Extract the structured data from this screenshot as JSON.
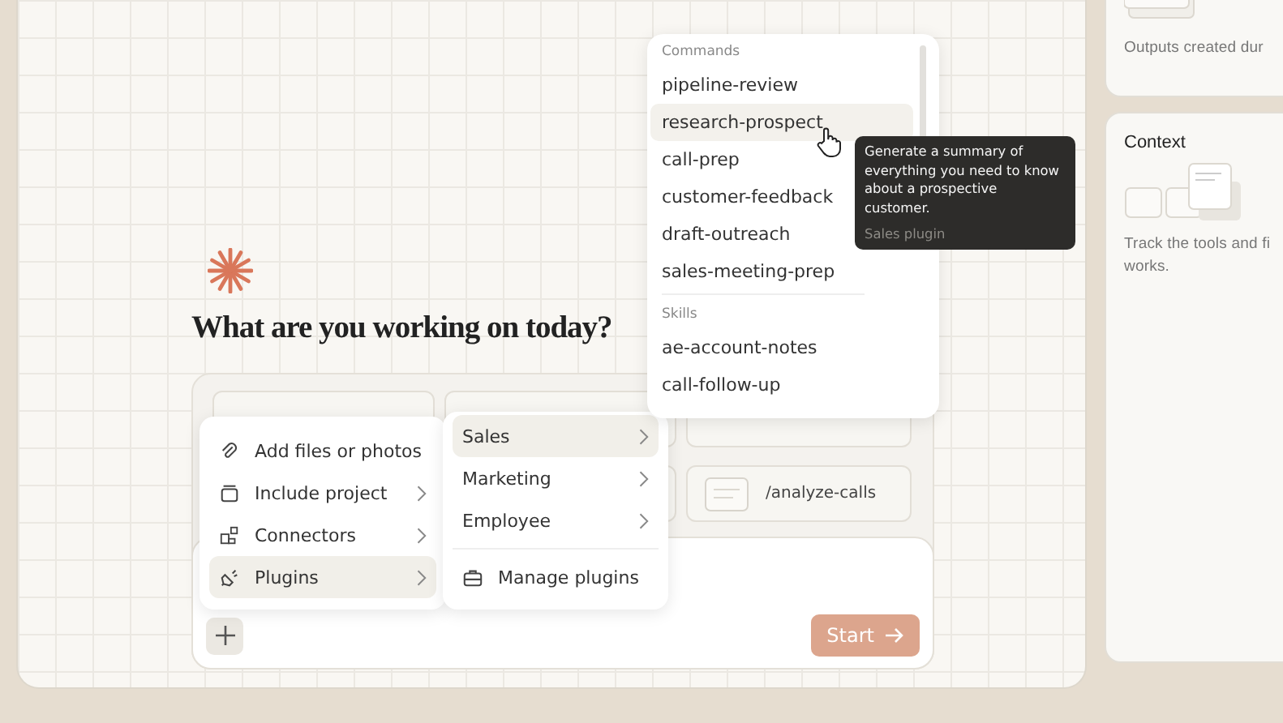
{
  "heading": "What are you working on today?",
  "suggestions": [
    {
      "label": "/analyze-calls"
    }
  ],
  "attach_menu": [
    {
      "label": "Add files or photos",
      "has_submenu": false,
      "selected": false
    },
    {
      "label": "Include project",
      "has_submenu": true,
      "selected": false
    },
    {
      "label": "Connectors",
      "has_submenu": true,
      "selected": false
    },
    {
      "label": "Plugins",
      "has_submenu": true,
      "selected": true
    }
  ],
  "plugin_menu": {
    "categories": [
      {
        "label": "Sales",
        "selected": true
      },
      {
        "label": "Marketing",
        "selected": false
      },
      {
        "label": "Employee",
        "selected": false
      }
    ],
    "manage": "Manage plugins"
  },
  "command_popup": {
    "sections": [
      {
        "title": "Commands",
        "items": [
          {
            "label": "pipeline-review",
            "selected": false
          },
          {
            "label": "research-prospect",
            "selected": true
          },
          {
            "label": "call-prep",
            "selected": false
          },
          {
            "label": "customer-feedback",
            "selected": false
          },
          {
            "label": "draft-outreach",
            "selected": false
          },
          {
            "label": "sales-meeting-prep",
            "selected": false
          }
        ]
      },
      {
        "title": "Skills",
        "items": [
          {
            "label": "ae-account-notes",
            "selected": false
          },
          {
            "label": "call-follow-up",
            "selected": false
          }
        ]
      }
    ]
  },
  "tooltip": {
    "text": "Generate a summary of everything you need to know about a prospective customer.",
    "source": "Sales plugin"
  },
  "composer": {
    "start_label": "Start",
    "start_disabled": true
  },
  "side_cards": [
    {
      "lines": [
        "Outputs created dur"
      ]
    },
    {
      "title": "Context",
      "lines": [
        "Track the tools and fi",
        "works."
      ]
    }
  ]
}
